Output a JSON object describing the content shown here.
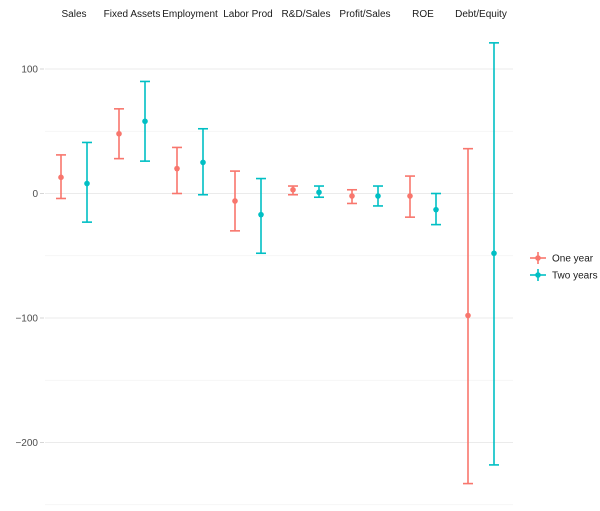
{
  "chart_data": {
    "type": "errorbar",
    "title": "",
    "xlabel": "",
    "ylabel": "",
    "ylim": [
      -255,
      130
    ],
    "yticks": [
      100,
      0,
      -100,
      -200
    ],
    "grid": true,
    "legend_position": "right",
    "categories": [
      "Sales",
      "Fixed Assets",
      "Employment",
      "Labor Prod",
      "R&D/Sales",
      "Profit/Sales",
      "ROE",
      "Debt/Equity"
    ],
    "series": [
      {
        "name": "One year",
        "color": "#F8766D",
        "values": [
          13,
          48,
          20,
          -6,
          3,
          -2,
          -2,
          -98
        ],
        "lower": [
          -4,
          28,
          0,
          -30,
          -1,
          -8,
          -19,
          -233
        ],
        "upper": [
          31,
          68,
          37,
          18,
          6,
          3,
          14,
          36
        ]
      },
      {
        "name": "Two years",
        "color": "#00BFC4",
        "values": [
          8,
          58,
          25,
          -17,
          1,
          -2,
          -13,
          -48
        ],
        "lower": [
          -23,
          26,
          -1,
          -48,
          -3,
          -10,
          -25,
          -218
        ],
        "upper": [
          41,
          90,
          52,
          12,
          6,
          6,
          0,
          121
        ]
      }
    ]
  }
}
